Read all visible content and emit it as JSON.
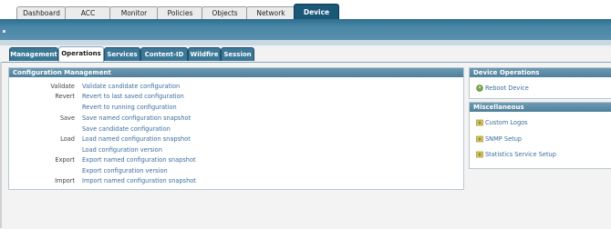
{
  "top_tabs": [
    {
      "label": "Dashboard",
      "active": false
    },
    {
      "label": "ACC",
      "active": false
    },
    {
      "label": "Monitor",
      "active": false
    },
    {
      "label": "Policies",
      "active": false
    },
    {
      "label": "Objects",
      "active": false
    },
    {
      "label": "Network",
      "active": false
    },
    {
      "label": "Device",
      "active": true
    }
  ],
  "sub_tabs": [
    {
      "label": "Management",
      "active": false
    },
    {
      "label": "Operations",
      "active": true
    },
    {
      "label": "Services",
      "active": false
    },
    {
      "label": "Content-ID",
      "active": false
    },
    {
      "label": "Wildfire",
      "active": false
    },
    {
      "label": "Session",
      "active": false
    }
  ],
  "config_mgmt": {
    "title": "Configuration Management",
    "rows": [
      {
        "label": "Validate",
        "link": "Validate candidate configuration"
      },
      {
        "label": "Revert",
        "link": "Revert to last saved configuration"
      },
      {
        "label": "",
        "link": "Revert to running configuration"
      },
      {
        "label": "Save",
        "link": "Save named configuration snapshot"
      },
      {
        "label": "",
        "link": "Save candidate configuration"
      },
      {
        "label": "Load",
        "link": "Load named configuration snapshot"
      },
      {
        "label": "",
        "link": "Load configuration version"
      },
      {
        "label": "Export",
        "link": "Export named configuration snapshot"
      },
      {
        "label": "",
        "link": "Export configuration version"
      },
      {
        "label": "Import",
        "link": "Import named configuration snapshot"
      }
    ]
  },
  "device_ops": {
    "title": "Device Operations",
    "items": [
      {
        "label": "Reboot Device",
        "icon": "reboot-icon"
      }
    ]
  },
  "misc": {
    "title": "Miscellaneous",
    "items": [
      {
        "label": "Custom Logos",
        "icon": "custom-logos-icon"
      },
      {
        "label": "SNMP Setup",
        "icon": "snmp-icon"
      },
      {
        "label": "Statistics Service Setup",
        "icon": "statistics-icon"
      }
    ]
  },
  "colors": {
    "accent": "#1b5878",
    "link": "#3a6e9e",
    "header": "#5a88a2"
  }
}
